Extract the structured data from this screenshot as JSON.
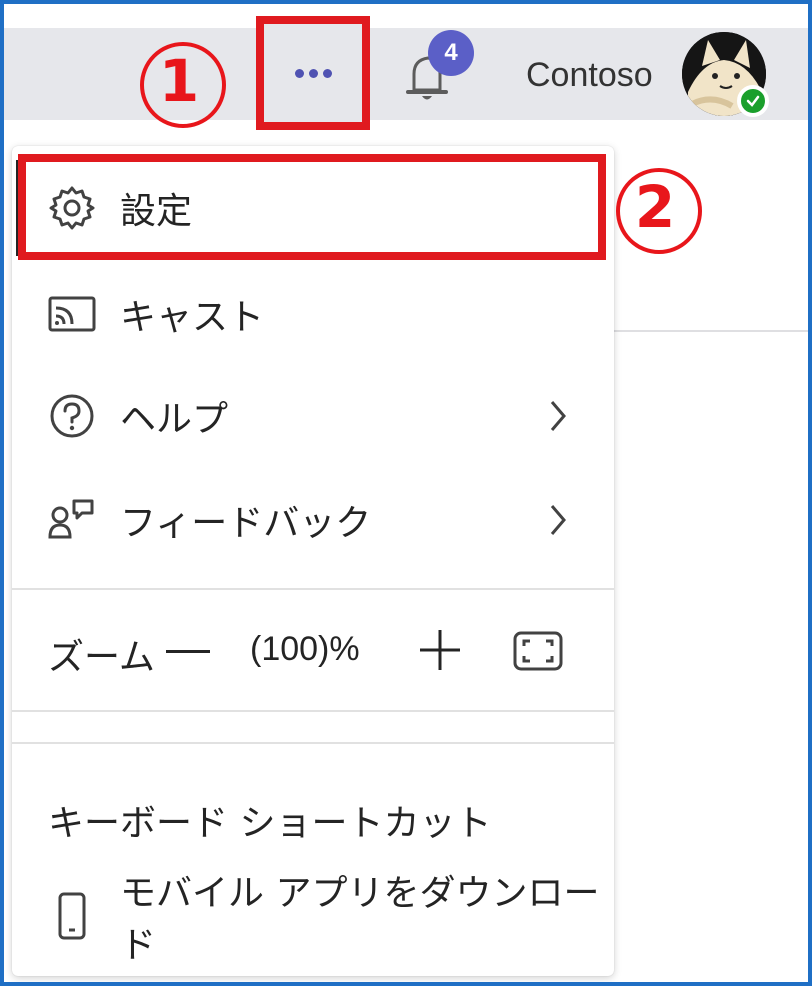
{
  "annotations": {
    "step1": "①",
    "step2": "②",
    "color": "#e01a1f"
  },
  "header": {
    "more_icon": "more-horizontal-icon",
    "notification_count": "4",
    "org_name": "Contoso",
    "status": "available"
  },
  "menu": {
    "items": [
      {
        "label": "設定",
        "icon": "gear-icon"
      },
      {
        "label": "キャスト",
        "icon": "cast-icon"
      },
      {
        "label": "ヘルプ",
        "icon": "help-circle-icon",
        "submenu": true
      },
      {
        "label": "フィードバック",
        "icon": "feedback-icon",
        "submenu": true
      }
    ],
    "zoom": {
      "label": "ズーム",
      "value": "(100)%"
    },
    "shortcuts_label": "キーボード ショートカット",
    "mobile_label": "モバイル アプリをダウンロード"
  },
  "colors": {
    "accent": "#5b5fc7",
    "frame": "#1f6fc5",
    "presence": "#1a9f2c"
  }
}
